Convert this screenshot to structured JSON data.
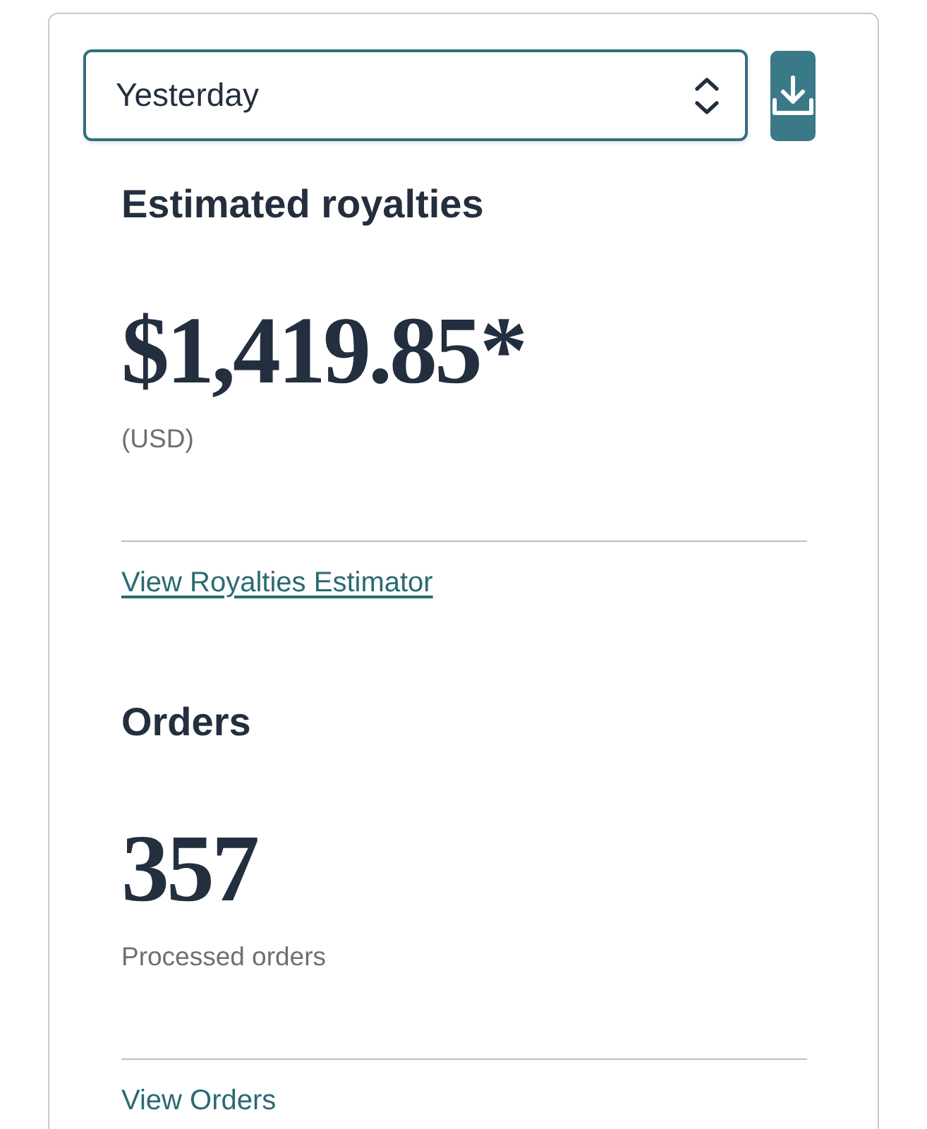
{
  "period_select": {
    "value": "Yesterday"
  },
  "sections": [
    {
      "title": "Estimated royalties",
      "value": "$1,419.85*",
      "caption": "(USD)",
      "link": {
        "label": "View Royalties Estimator",
        "underlined": true
      }
    },
    {
      "title": "Orders",
      "value": "357",
      "caption": "Processed orders",
      "link": {
        "label": "View Orders",
        "underlined": false
      }
    }
  ]
}
